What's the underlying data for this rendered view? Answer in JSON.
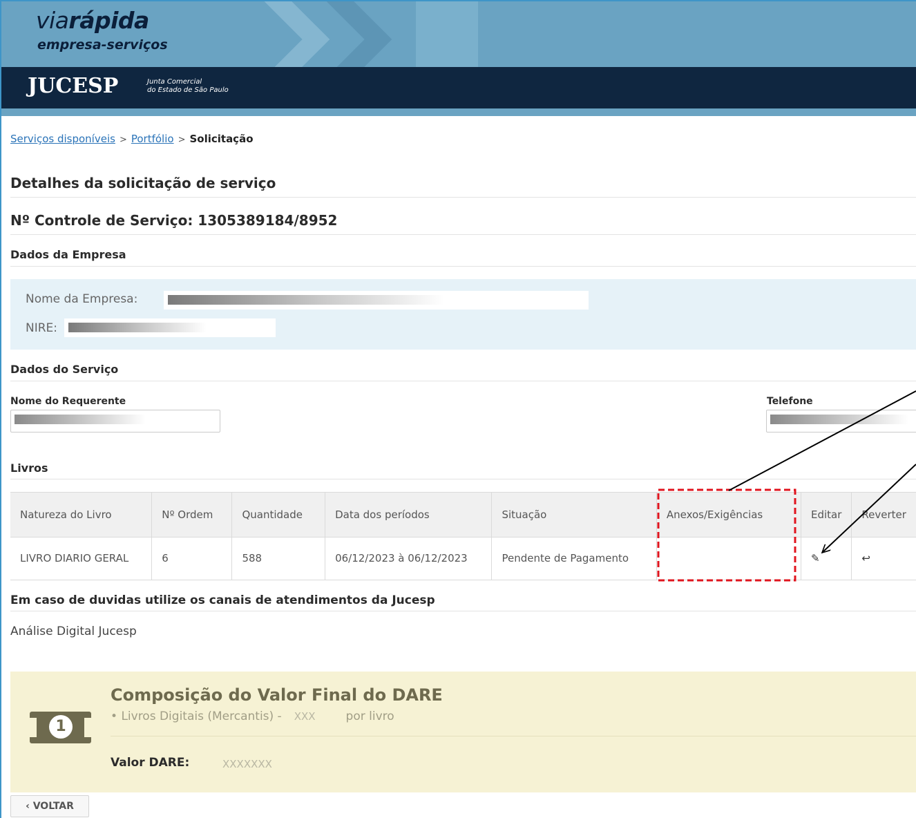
{
  "header": {
    "logo_via": "via",
    "logo_rapida": "rápida",
    "logo_sub": "empresa-serviços",
    "org_name": "JUCESP",
    "org_sub_line1": "Junta Comercial",
    "org_sub_line2": "do Estado de São Paulo"
  },
  "breadcrumb": {
    "item1": "Serviços disponíveis",
    "item2": "Portfólio",
    "current": "Solicitação",
    "separator": ">"
  },
  "page": {
    "title": "Detalhes da solicitação de serviço",
    "control": "Nº Controle de Serviço: 1305389184/8952"
  },
  "company": {
    "section": "Dados da Empresa",
    "name_label": "Nome da Empresa:",
    "nire_label": "NIRE:"
  },
  "service": {
    "section": "Dados do Serviço",
    "requester_label": "Nome do Requerente",
    "phone_label": "Telefone"
  },
  "books": {
    "section": "Livros",
    "headers": [
      "Natureza do Livro",
      "Nº Ordem",
      "Quantidade",
      "Data dos períodos",
      "Situação",
      "Anexos/Exigências",
      "Editar",
      "Reverter"
    ],
    "rows": [
      {
        "nature": "LIVRO DIARIO GERAL",
        "order": "6",
        "quantity": "588",
        "period": "06/12/2023 à 06/12/2023",
        "status": "Pendente de Pagamento",
        "attachments": ""
      }
    ]
  },
  "contact": {
    "title": "Em caso de duvidas utilize os canais de atendimentos da Jucesp",
    "text": "Análise Digital Jucesp"
  },
  "dare": {
    "title": "Composição do Valor Final do DARE",
    "bullet": "•",
    "item_label": "Livros Digitais (Mercantis) -",
    "item_value": "XXX",
    "item_suffix": "por livro",
    "value_label": "Valor DARE:",
    "value": "XXXXXXX",
    "icon_digit": "1"
  },
  "actions": {
    "back_label": "‹ VOLTAR"
  },
  "icons": {
    "edit": "✎",
    "revert": "↩"
  },
  "colors": {
    "banner": "#6aa3c2",
    "header_bar": "#0f2640",
    "company_box": "#e6f2f8",
    "dare_box": "#f6f2d4",
    "highlight": "#e0141e"
  }
}
